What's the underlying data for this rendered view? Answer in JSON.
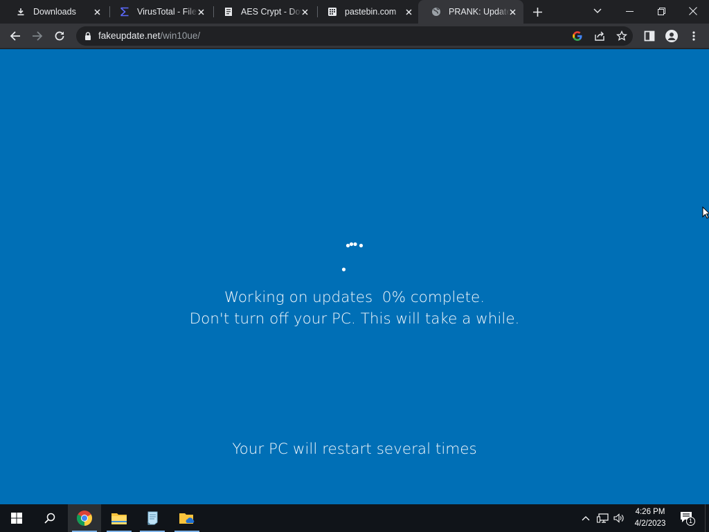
{
  "browser": {
    "tabs": [
      {
        "title": "Downloads",
        "icon": "download-icon",
        "active": false
      },
      {
        "title": "VirusTotal - File",
        "icon": "virustotal-icon",
        "active": false
      },
      {
        "title": "AES Crypt - Dow",
        "icon": "aescrypt-icon",
        "active": false
      },
      {
        "title": "pastebin.com",
        "icon": "pastebin-icon",
        "active": false
      },
      {
        "title": "PRANK: Update",
        "icon": "globe-icon",
        "active": true
      }
    ],
    "address": {
      "host": "fakeupdate.net",
      "path": "/win10ue/"
    }
  },
  "page": {
    "line1": "Working on updates  0% complete.",
    "line2": "Don't turn off your PC. This will take a while.",
    "line3": "Your PC will restart several times",
    "progress_percent": 0,
    "background_color": "#006fb6"
  },
  "taskbar": {
    "time": "4:26 PM",
    "date": "4/2/2023",
    "notification_count": "1",
    "apps": [
      "chrome-icon",
      "file-explorer-icon",
      "notepad-icon",
      "onedrive-folder-icon"
    ]
  }
}
